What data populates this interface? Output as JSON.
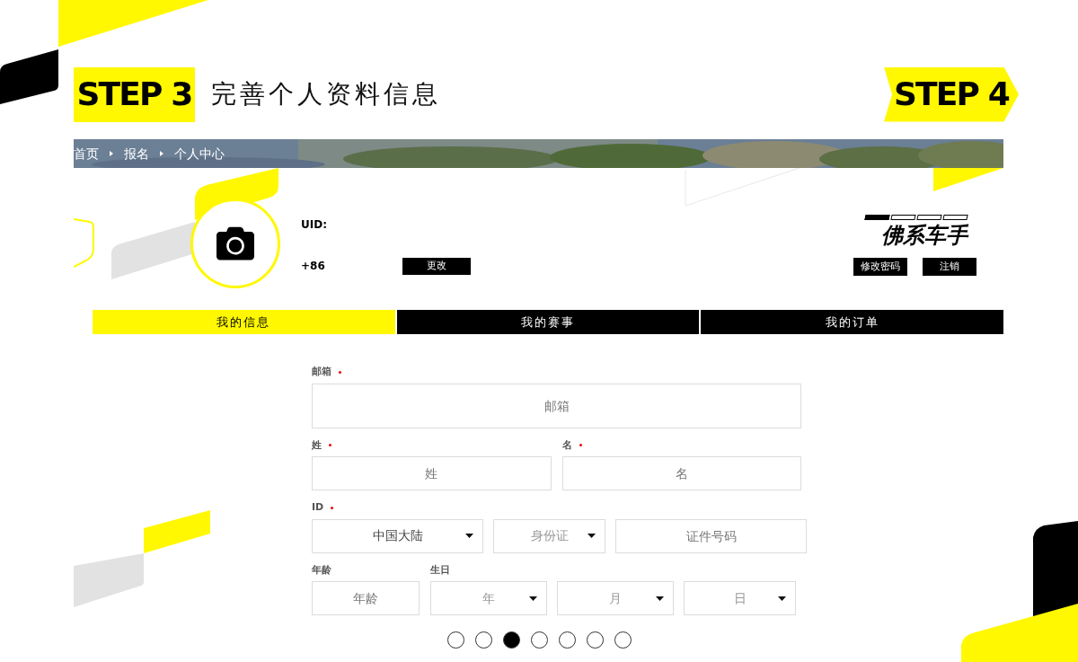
{
  "current_step": {
    "label": "STEP 3",
    "title": "完善个人资料信息"
  },
  "next_step": {
    "label": "STEP 4"
  },
  "breadcrumb": [
    "首页",
    "报名",
    "个人中心"
  ],
  "profile": {
    "uid_label": "UID:",
    "phone_prefix": "+86",
    "change_button": "更改",
    "rank": {
      "level": 0.25,
      "title": "佛系车手"
    },
    "account_buttons": [
      "修改密码",
      "注销"
    ]
  },
  "tabs": [
    {
      "label": "我的信息",
      "selected": true
    },
    {
      "label": "我的赛事",
      "selected": false
    },
    {
      "label": "我的订单",
      "selected": false
    }
  ],
  "form": {
    "rows": [
      {
        "groups": [
          {
            "label": "邮箱",
            "required": true,
            "inputs": [
              {
                "kind": "text",
                "placeholder": "邮箱"
              }
            ]
          }
        ]
      },
      {
        "groups": [
          {
            "label": "姓",
            "required": true,
            "inputs": [
              {
                "kind": "text",
                "placeholder": "姓"
              }
            ]
          },
          {
            "label": "名",
            "required": true,
            "inputs": [
              {
                "kind": "text",
                "placeholder": "名"
              }
            ]
          }
        ]
      },
      {
        "groups": [
          {
            "label": "ID",
            "required": true,
            "inputs": [
              {
                "kind": "select",
                "value": "中国大陆"
              },
              {
                "kind": "select",
                "placeholder": "身份证"
              },
              {
                "kind": "text",
                "placeholder": "证件号码"
              }
            ]
          }
        ]
      },
      {
        "groups": [
          {
            "label": "年龄",
            "required": false,
            "inputs": [
              {
                "kind": "text",
                "placeholder": "年龄"
              }
            ]
          },
          {
            "label": "生日",
            "required": false,
            "inputs": [
              {
                "kind": "select",
                "placeholder": "年"
              },
              {
                "kind": "select",
                "placeholder": "月"
              },
              {
                "kind": "select",
                "placeholder": "日"
              }
            ]
          }
        ]
      }
    ]
  },
  "pagination": [
    {
      "selected": false
    },
    {
      "selected": false
    },
    {
      "selected": true
    },
    {
      "selected": false
    },
    {
      "selected": false
    },
    {
      "selected": false
    },
    {
      "selected": false
    }
  ]
}
